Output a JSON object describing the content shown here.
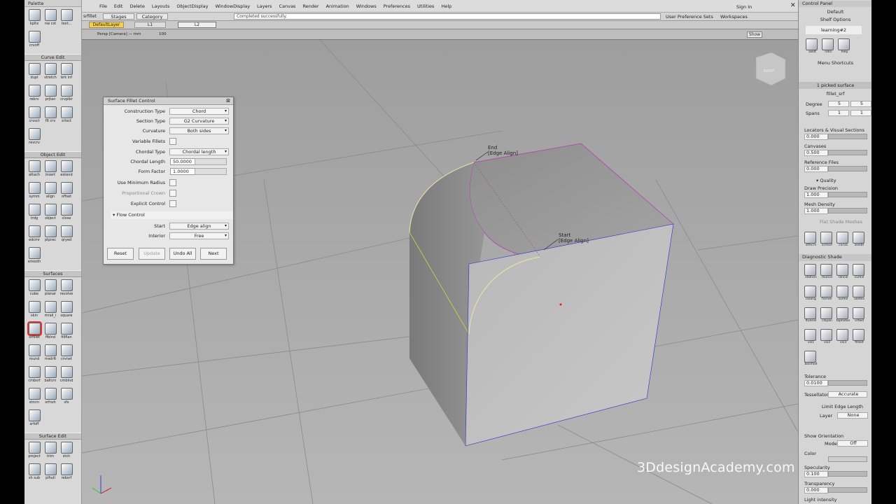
{
  "palette": {
    "title": "Palette",
    "top_tools": [
      "kpltx",
      "nw cst",
      "text..."
    ],
    "top_tools2": [
      "crvoff"
    ],
    "sections": [
      {
        "name": "Curve Edit",
        "tools": [
          "dupl",
          "stretch",
          "brk inf",
          "rebrv",
          "prjtan",
          "crvplbr",
          "crvsct",
          "flt crv",
          "srtsct",
          "revcrv"
        ]
      },
      {
        "name": "Object Edit",
        "tools": [
          "attach",
          "insert",
          "extend",
          "symm",
          "align",
          "offset",
          "trdg",
          "object",
          "close",
          "edcmr",
          "ptprec",
          "qryed",
          "smooth"
        ]
      },
      {
        "name": "Surfaces",
        "tools": [
          "cube",
          "planar",
          "revolve",
          "skin",
          "mrail_i",
          "square",
          "srfillet",
          "ffblnd",
          "fillflan",
          "round",
          "msdrft",
          "crvnet",
          "cmbsrf",
          "ballcrn",
          "cmblnd",
          "strcrn",
          "srfnsh",
          "sfs",
          "srfoff"
        ]
      },
      {
        "name": "Surface Edit",
        "tools": [
          "project",
          "trim",
          "stch",
          "sh sub",
          "plhull",
          "rebsrf"
        ]
      }
    ]
  },
  "menubar": {
    "items": [
      "File",
      "Edit",
      "Delete",
      "Layouts",
      "ObjectDisplay",
      "WindowDisplay",
      "Layers",
      "Canvas",
      "Render",
      "Animation",
      "Windows",
      "Preferences",
      "Utilities",
      "Help"
    ],
    "sign_in": "Sign In"
  },
  "toolbar": {
    "tab_stages": "Stages",
    "tab_category": "Category",
    "status_message": "Completed successfully.",
    "user_pref_sets": "User Preference Sets",
    "workspaces": "Workspaces",
    "layer_default": "DefaultLayer",
    "layer_l1": "L1",
    "layer_l2": "L2",
    "sfillet": "srfillet"
  },
  "viewport": {
    "camera_label": "Persp [Camera] — mm",
    "zoom_label": "100",
    "show_button": "Show",
    "view_cube_label": "RIGHT",
    "annotation_end": "End",
    "annotation_end_sub": "[Edge Align]",
    "annotation_start": "Start",
    "annotation_start_sub": "[Edge Align]",
    "watermark": "3DdesignAcademy.com"
  },
  "fillet_dialog": {
    "title": "Surface Fillet Control",
    "construction_type_label": "Construction Type",
    "construction_type": "Chord",
    "section_type_label": "Section Type",
    "section_type": "G2 Curvature",
    "curvature_label": "Curvature",
    "curvature": "Both sides",
    "variable_fillets_label": "Variable Fillets",
    "chordal_type_label": "Chordal Type",
    "chordal_type": "Chordal length",
    "chordal_length_label": "Chordal Length",
    "chordal_length": "50.0000",
    "form_factor_label": "Form Factor",
    "form_factor": "1.0000",
    "use_min_radius_label": "Use Minimum Radius",
    "proportional_crown_label": "Proportional Crown",
    "explicit_control_label": "Explicit Control",
    "flow_control_label": "Flow Control",
    "start_label": "Start",
    "start": "Edge align",
    "interior_label": "Interior",
    "interior": "Free",
    "reset": "Reset",
    "update": "Update",
    "undo_all": "Undo All",
    "next": "Next"
  },
  "control_panel": {
    "title": "Control Panel",
    "default": "Default",
    "shelf_options": "Shelf Options",
    "shelf_name": "learning#2",
    "shelf_tools": [
      "asklt",
      "rotrc",
      "help"
    ],
    "menu_shortcuts": "Menu Shortcuts",
    "picked": "1 picked surface",
    "object_name": "fillet_srf",
    "degree_label": "Degree",
    "degree_u": "5",
    "degree_v": "5",
    "spans_label": "Spans",
    "spans_u": "1",
    "spans_v": "1",
    "locators_label": "Locators & Visual Sections",
    "locators_value": "0.000",
    "canvases_label": "Canvases",
    "canvases_value": "0.500",
    "reference_files_label": "Reference Files",
    "reference_files_value": "0.000",
    "quality_label": "Quality",
    "draw_precision_label": "Draw Precision",
    "draw_precision_value": "1.000",
    "mesh_density_label": "Mesh Density",
    "mesh_density_value": "1.000",
    "flat_shade_label": "Flat Shade Meshes",
    "mid_tools": [
      "sfmcrv",
      "scmsrf",
      "curva",
      "zsedit"
    ],
    "diag_shade_label": "Diagnostic Shade",
    "diag_tools": [
      "shdnon",
      "mulcol",
      "rancol",
      "curevl",
      "isoang",
      "horver",
      "surevl",
      "usetex",
      "ltunnel",
      "clayan",
      "tophotes",
      "vrtwd",
      "vis1",
      "vis2",
      "vis3",
      "fillset",
      "bosmod"
    ],
    "tolerance_label": "Tolerance",
    "tolerance_value": "0.0100",
    "tessellator_label": "Tessellator",
    "tessellator_value": "Accurate",
    "limit_edge_label": "Limit Edge Length",
    "layer_label": "Layer",
    "layer_value": "None",
    "show_orientation_label": "Show Orientation",
    "mode_label": "Mode",
    "mode_value": "Off",
    "color_label": "Color",
    "specularity_label": "Specularity",
    "specularity_value": "0.100",
    "transparency_label": "Transparency",
    "transparency_value": "0.000",
    "light_intensity_label": "Light intensity"
  }
}
